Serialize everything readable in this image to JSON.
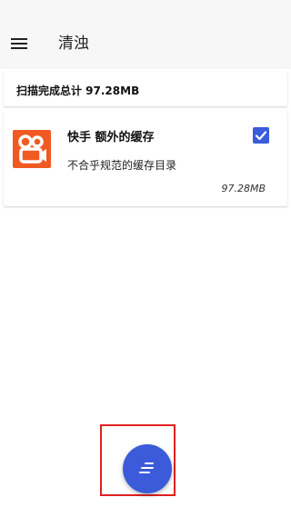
{
  "header": {
    "menu_icon": "hamburger-menu-icon",
    "title": "清浊"
  },
  "summary": {
    "text": "扫描完成总计 97.28MB"
  },
  "items": [
    {
      "icon": "kuaishou-app-icon",
      "title": "快手 额外的缓存",
      "description": "不合乎规范的缓存目录",
      "size": "97.28MB",
      "checked": true
    }
  ],
  "fab": {
    "icon": "clean-lines-icon"
  },
  "colors": {
    "accent": "#3b5bdb",
    "app_icon_bg": "#f05a22",
    "highlight_border": "#e02020"
  }
}
